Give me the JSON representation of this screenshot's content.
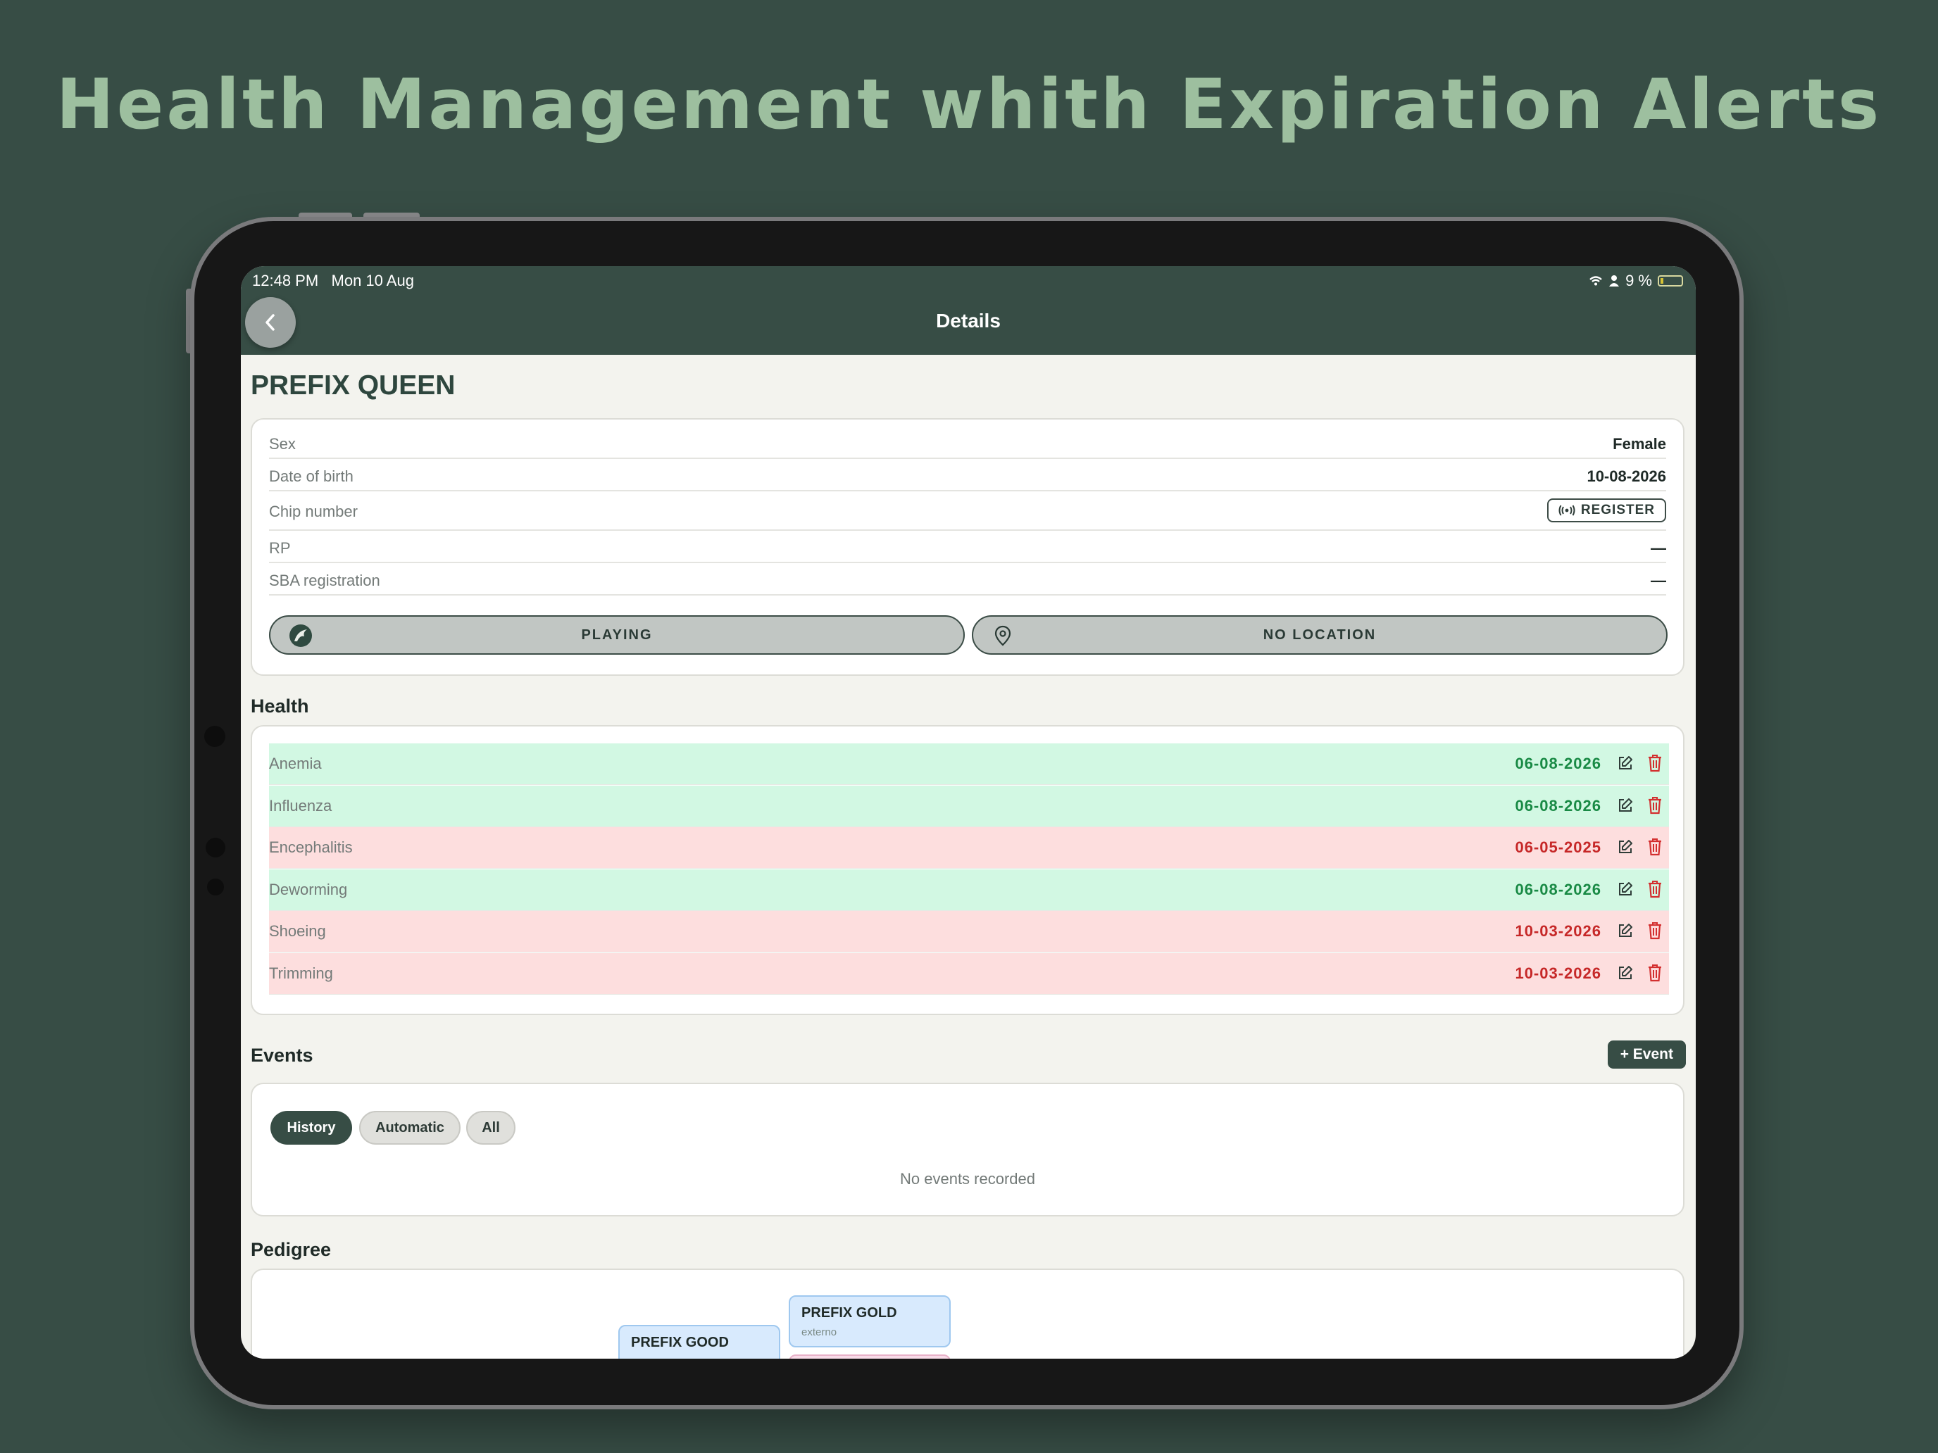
{
  "headline": "Health Management whith Expiration Alerts",
  "status_bar": {
    "time": "12:48 PM",
    "date": "Mon 10 Aug",
    "battery": "9 %"
  },
  "nav": {
    "title": "Details",
    "back_icon": "chevron-left-icon"
  },
  "horse": {
    "name": "PREFIX QUEEN",
    "fields": [
      {
        "label": "Sex",
        "value": "Female"
      },
      {
        "label": "Date of birth",
        "value": "10-08-2026"
      },
      {
        "label": "Chip number",
        "action": "REGISTER"
      },
      {
        "label": "RP",
        "value": "—"
      },
      {
        "label": "SBA registration",
        "value": "—"
      }
    ],
    "activity_label": "PLAYING",
    "location_label": "NO LOCATION"
  },
  "health": {
    "title": "Health",
    "items": [
      {
        "name": "Anemia",
        "date": "06-08-2026",
        "status": "ok"
      },
      {
        "name": "Influenza",
        "date": "06-08-2026",
        "status": "ok"
      },
      {
        "name": "Encephalitis",
        "date": "06-05-2025",
        "status": "expired"
      },
      {
        "name": "Deworming",
        "date": "06-08-2026",
        "status": "ok"
      },
      {
        "name": "Shoeing",
        "date": "10-03-2026",
        "status": "expired"
      },
      {
        "name": "Trimming",
        "date": "10-03-2026",
        "status": "expired"
      }
    ]
  },
  "events": {
    "title": "Events",
    "add_label": "+ Event",
    "tabs": [
      "History",
      "Automatic",
      "All"
    ],
    "active_tab": "History",
    "empty_text": "No events recorded"
  },
  "pedigree": {
    "title": "Pedigree",
    "nodes": [
      {
        "name": "PREFIX GOOD",
        "sub": ""
      },
      {
        "name": "PREFIX GOLD",
        "sub": "externo"
      }
    ]
  },
  "colors": {
    "brand": "#374d45",
    "ok_bg": "#d2f8e3",
    "expired_bg": "#fddede",
    "ok_text": "#198a45",
    "expired_text": "#c62828"
  }
}
